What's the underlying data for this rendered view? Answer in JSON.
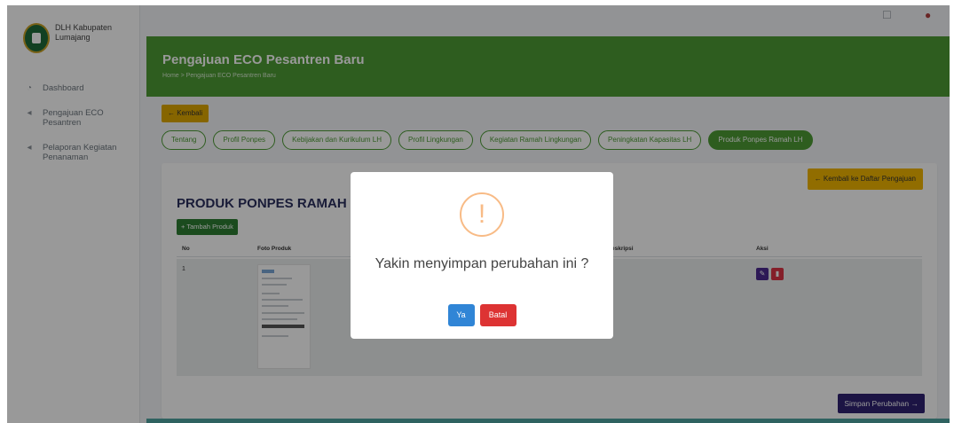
{
  "brand": {
    "name": "DLH Kabupaten Lumajang"
  },
  "sidebar": {
    "items": [
      {
        "label": "Dashboard",
        "icon": "gauge-icon"
      },
      {
        "label": "Pengajuan ECO Pesantren",
        "icon": "send-icon"
      },
      {
        "label": "Pelaporan Kegiatan Penanaman",
        "icon": "send-icon"
      }
    ]
  },
  "header": {
    "title": "Pengajuan ECO Pesantren Baru",
    "breadcrumb": "Home  >  Pengajuan ECO Pesantren Baru"
  },
  "toolbar": {
    "kembali_label": "← Kembali"
  },
  "tabs": [
    {
      "label": "Tentang",
      "active": false
    },
    {
      "label": "Profil Ponpes",
      "active": false
    },
    {
      "label": "Kebijakan dan Kurikulum LH",
      "active": false
    },
    {
      "label": "Profil Lingkungan",
      "active": false
    },
    {
      "label": "Kegiatan Ramah Lingkungan",
      "active": false
    },
    {
      "label": "Peningkatan Kapasitas LH",
      "active": false
    },
    {
      "label": "Produk Ponpes Ramah LH",
      "active": true
    }
  ],
  "card": {
    "back_list_label": "← Kembali ke Daftar Pengajuan",
    "section_title": "PRODUK PONPES RAMAH LH",
    "add_label": "+ Tambah Produk",
    "columns": {
      "no": "No",
      "foto": "Foto Produk",
      "deskripsi": "eskripsi",
      "aksi": "Aksi"
    },
    "rows": [
      {
        "no": "1"
      }
    ],
    "save_label": "Simpan Perubahan →"
  },
  "modal": {
    "icon": "!",
    "title": "Yakin menyimpan perubahan ini ?",
    "confirm_label": "Ya",
    "cancel_label": "Batal"
  },
  "colors": {
    "primary_green": "#4d9c35",
    "warning": "#f2b600",
    "confirm": "#3085d6",
    "cancel": "#dd3333",
    "navy": "#2f2272"
  }
}
